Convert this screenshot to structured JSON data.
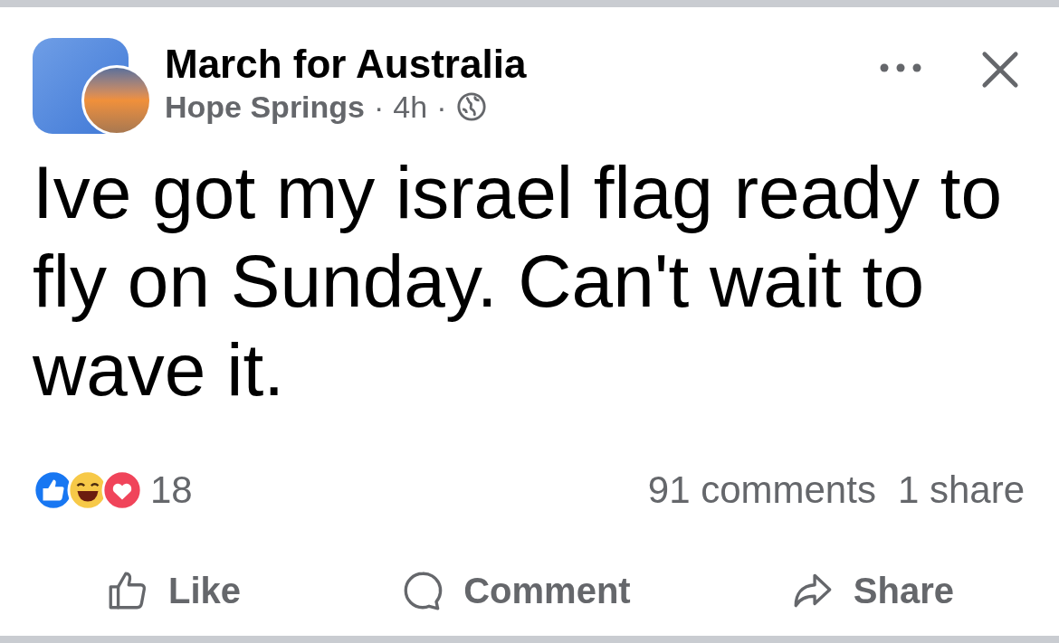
{
  "post": {
    "author": "March for Australia",
    "subtitle": "Hope Springs",
    "separator_1": "·",
    "time": "4h",
    "separator_2": "·",
    "text": "Ive got my israel flag ready to fly on Sunday.  Can't wait to wave it."
  },
  "reactions": {
    "count": "18",
    "comments": "91 comments",
    "shares": "1 share"
  },
  "actions": [
    {
      "kind": "like",
      "label": "Like"
    },
    {
      "kind": "comment",
      "label": "Comment"
    },
    {
      "kind": "share",
      "label": "Share"
    }
  ]
}
